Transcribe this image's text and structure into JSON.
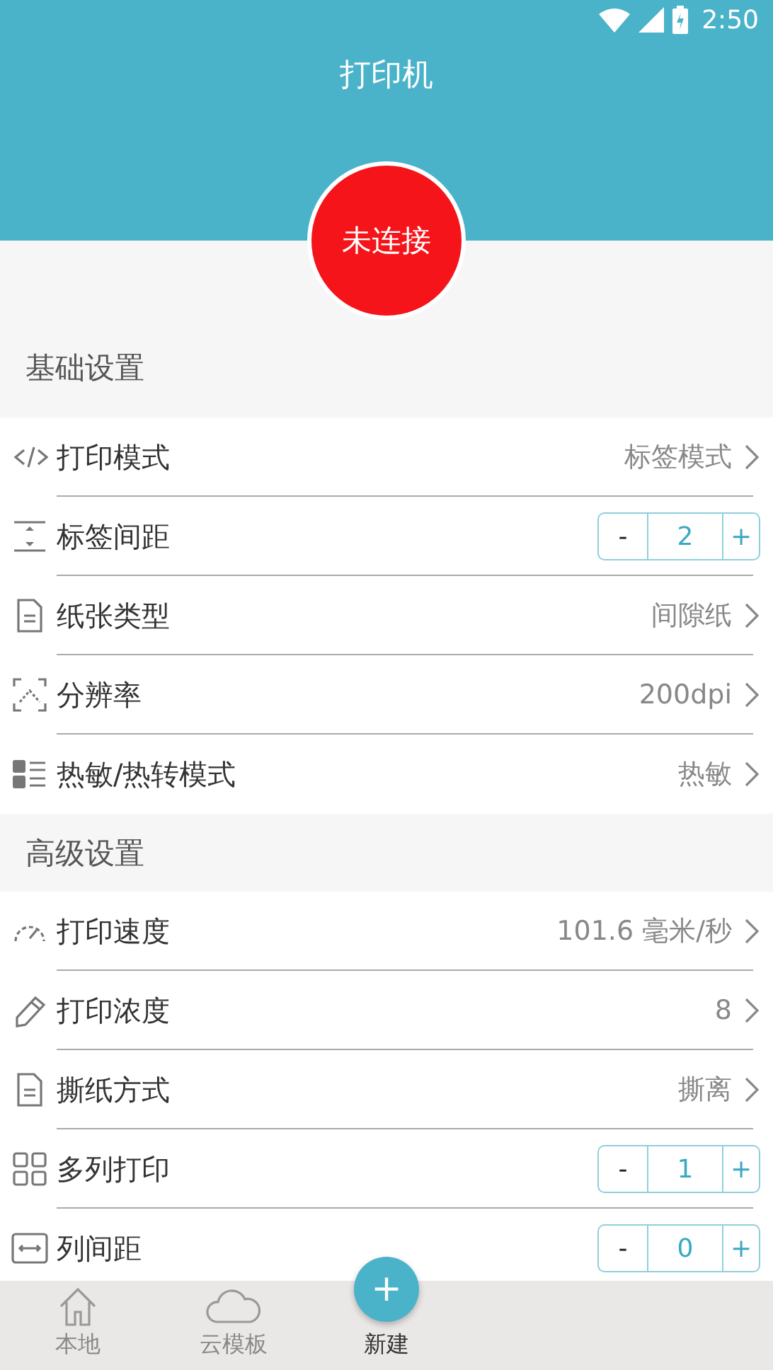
{
  "status_bar": {
    "time": "2:50"
  },
  "header": {
    "title": "打印机"
  },
  "connection": {
    "label": "未连接",
    "connected": false
  },
  "sections": [
    {
      "title": "基础设置",
      "rows": [
        {
          "kind": "select",
          "label": "打印模式",
          "value": "标签模式"
        },
        {
          "kind": "stepper",
          "label": "标签间距",
          "minus": "-",
          "value": "2",
          "plus": "+"
        },
        {
          "kind": "select",
          "label": "纸张类型",
          "value": "间隙纸"
        },
        {
          "kind": "select",
          "label": "分辨率",
          "value": "200dpi"
        },
        {
          "kind": "select",
          "label": "热敏/热转模式",
          "value": "热敏"
        }
      ]
    },
    {
      "title": "高级设置",
      "rows": [
        {
          "kind": "select",
          "label": "打印速度",
          "value": "101.6 毫米/秒"
        },
        {
          "kind": "select",
          "label": "打印浓度",
          "value": "8"
        },
        {
          "kind": "select",
          "label": "撕纸方式",
          "value": "撕离"
        },
        {
          "kind": "stepper",
          "label": "多列打印",
          "minus": "-",
          "value": "1",
          "plus": "+"
        },
        {
          "kind": "stepper",
          "label": "列间距",
          "minus": "-",
          "value": "0",
          "plus": "+"
        }
      ]
    }
  ],
  "tab_bar": [
    {
      "kind": "tab",
      "label": "本地"
    },
    {
      "kind": "tab",
      "label": "云模板"
    },
    {
      "kind": "fab",
      "symbol": "+",
      "label": "新建"
    }
  ]
}
